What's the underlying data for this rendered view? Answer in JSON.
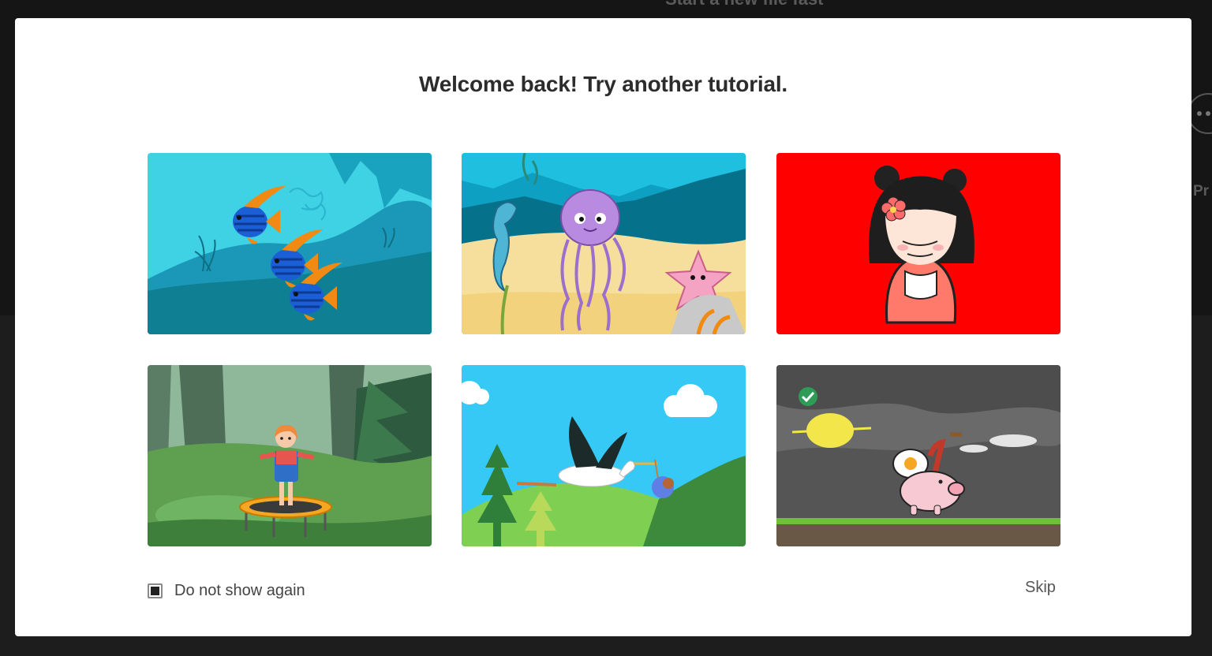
{
  "background": {
    "heading": "Start a new file fast",
    "side_label": "Pr"
  },
  "dialog": {
    "title": "Welcome back! Try another tutorial.",
    "tutorials": [
      {
        "scene": "three striped fish swimming underwater",
        "completed": false
      },
      {
        "scene": "jellyfish, seahorse and starfish on sandy seabed",
        "completed": false
      },
      {
        "scene": "girl with bangs and flower in hair on red background",
        "completed": false
      },
      {
        "scene": "girl jumping on trampoline in a forest",
        "completed": false
      },
      {
        "scene": "stork carrying a baby over green hills",
        "completed": false
      },
      {
        "scene": "pig carrying a fried egg and bacon on a stormy day",
        "completed": true
      }
    ],
    "dont_show_label": "Do not show again",
    "dont_show_checked": true,
    "skip_label": "Skip"
  },
  "colors": {
    "underwater": "#40d4e6",
    "red_bg": "#ff0000",
    "sky": "#36c9f5",
    "completed_check": "#2e9c57"
  }
}
